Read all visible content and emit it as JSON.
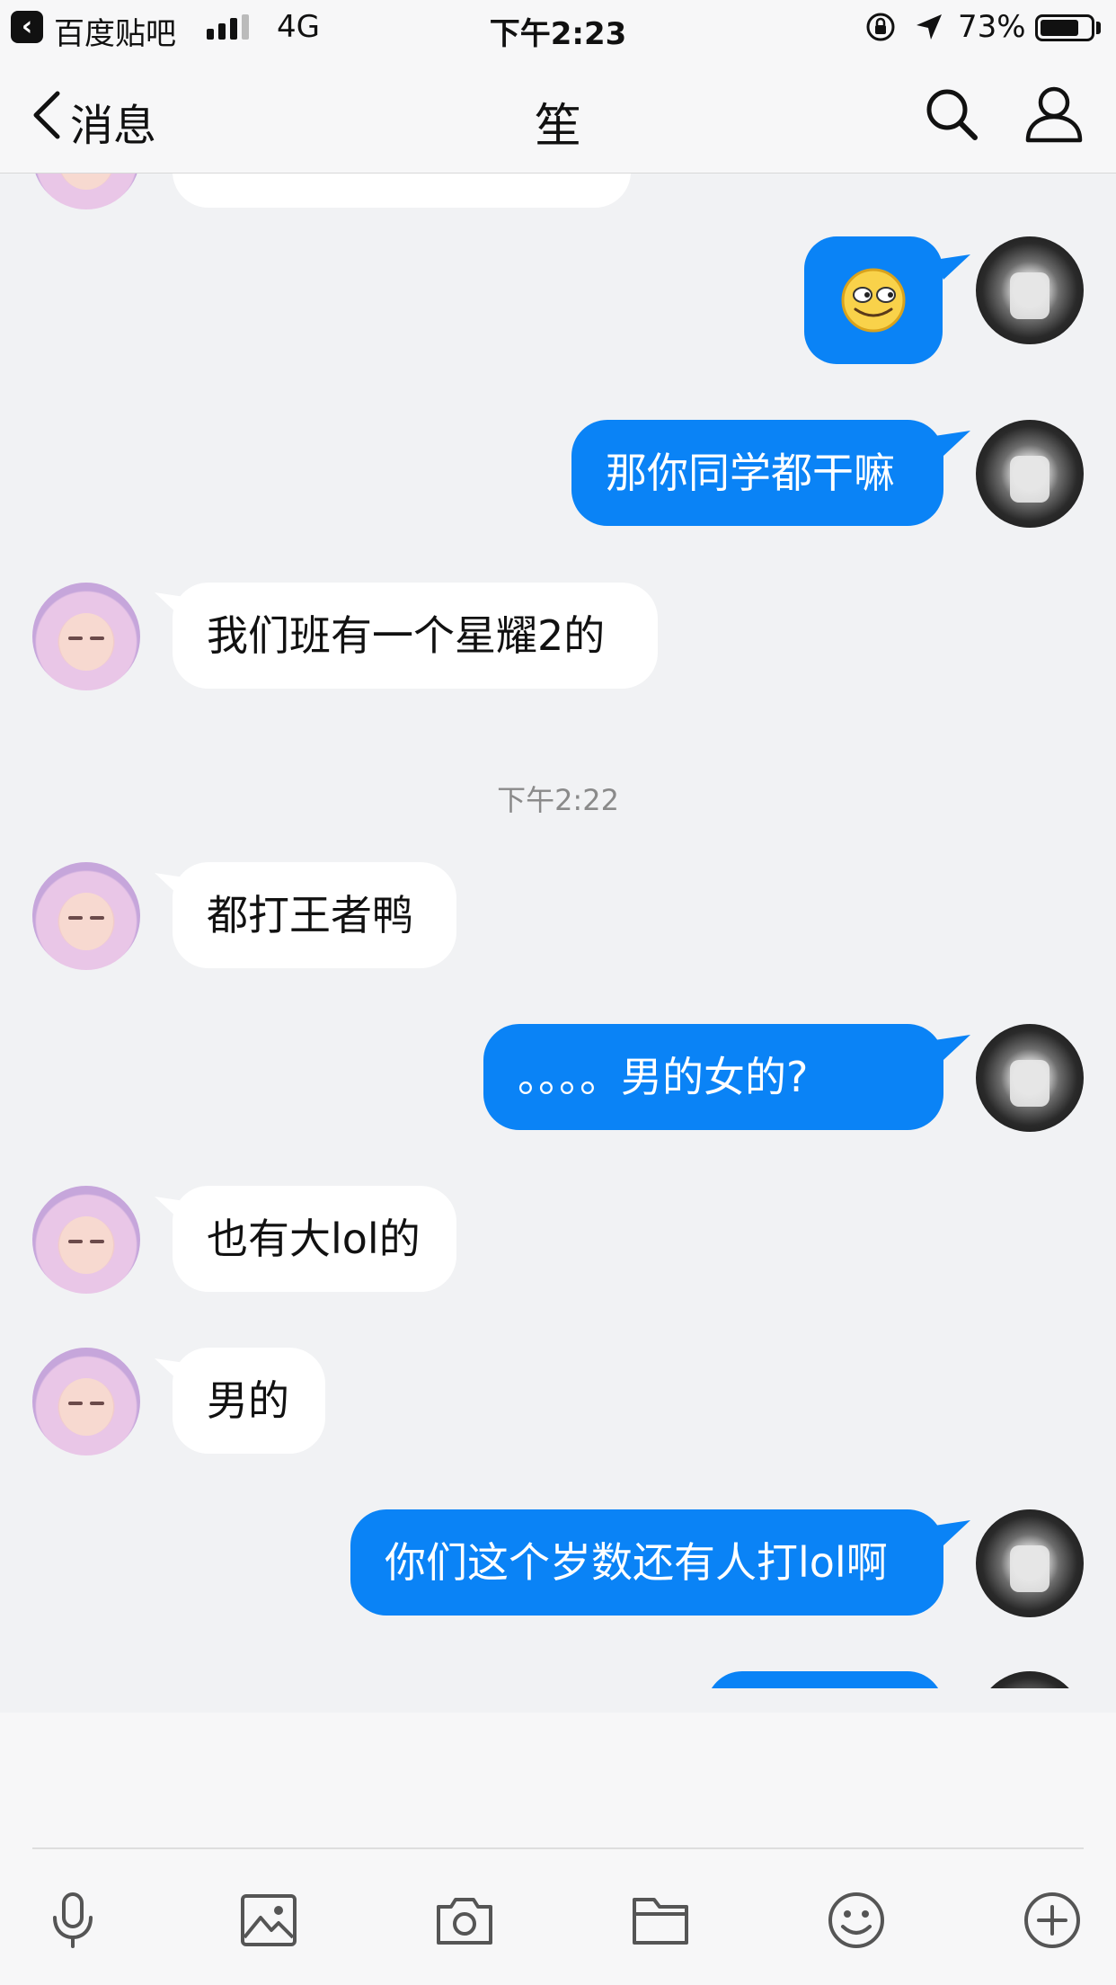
{
  "status_bar": {
    "back_app": "百度贴吧",
    "network": "4G",
    "time": "下午2:23",
    "battery": "73%"
  },
  "nav": {
    "back_label": "消息",
    "title": "笙"
  },
  "chat": {
    "timestamp": "下午2:22",
    "messages": [
      {
        "from": "me",
        "text": "那你同学都干嘛"
      },
      {
        "from": "them",
        "text": "我们班有一个星耀2的"
      },
      {
        "from": "them",
        "text": "都打王者鸭"
      },
      {
        "from": "me",
        "text": "。。。。男的女的?"
      },
      {
        "from": "them",
        "text": "也有大lol的"
      },
      {
        "from": "them",
        "text": "男的"
      },
      {
        "from": "me",
        "text": "你们这个岁数还有人打lol啊"
      }
    ]
  },
  "colors": {
    "my_bubble": "#0a83f6",
    "their_bubble": "#ffffff",
    "background": "#f1f2f4"
  },
  "toolbar": {
    "icons": [
      "microphone-icon",
      "image-icon",
      "camera-icon",
      "folder-icon",
      "emoji-icon",
      "plus-icon"
    ]
  }
}
